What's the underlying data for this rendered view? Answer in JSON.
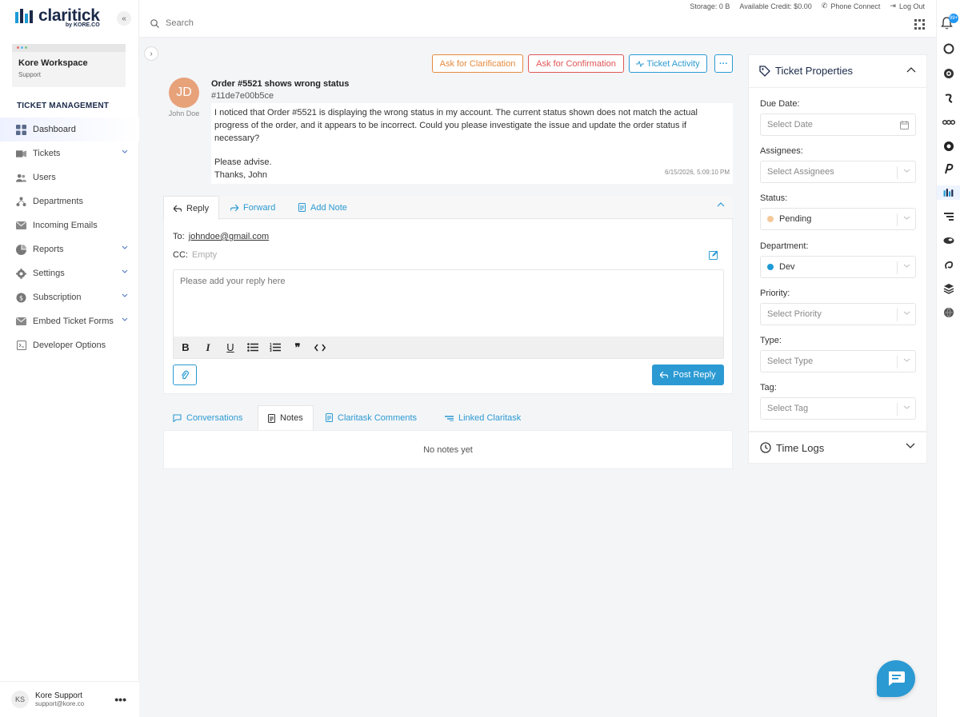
{
  "brand": {
    "name": "claritick",
    "by": "by KORE.CO",
    "accent": "#2b9ad3"
  },
  "topbar": {
    "storage": "Storage: 0 B",
    "credit": "Available Credit: $0.00",
    "phone": "Phone Connect",
    "logout": "Log Out",
    "search_placeholder": "Search",
    "notification_count": "99+"
  },
  "sidebar": {
    "workspace_name": "Kore Workspace",
    "workspace_role": "Support",
    "section_title": "TICKET MANAGEMENT",
    "items": [
      {
        "label": "Dashboard",
        "icon": "dashboard-icon"
      },
      {
        "label": "Tickets",
        "icon": "ticket-icon"
      },
      {
        "label": "Users",
        "icon": "users-icon"
      },
      {
        "label": "Departments",
        "icon": "departments-icon"
      },
      {
        "label": "Incoming Emails",
        "icon": "mail-icon"
      },
      {
        "label": "Reports",
        "icon": "reports-icon"
      },
      {
        "label": "Settings",
        "icon": "gear-icon"
      },
      {
        "label": "Subscription",
        "icon": "subscription-icon"
      },
      {
        "label": "Embed Ticket Forms",
        "icon": "embed-icon"
      },
      {
        "label": "Developer Options",
        "icon": "developer-icon"
      }
    ],
    "user": {
      "initials": "KS",
      "name": "Kore Support",
      "email": "support@kore.co"
    }
  },
  "actions": {
    "clarification": "Ask for Clarification",
    "confirmation": "Ask for Confirmation",
    "activity": "Ticket Activity",
    "more": "···"
  },
  "ticket": {
    "avatar_initials": "JD",
    "author": "John Doe",
    "title": "Order #5521 shows wrong status",
    "id": "#11de7e00b5ce",
    "body_lines": [
      "I noticed that Order #5521 is displaying the wrong status in my account. The current status shown does not match the actual progress of the order, and it appears to be incorrect. Could you please investigate the issue and update the order status if necessary?",
      "Please advise.",
      "Thanks, John"
    ],
    "timestamp": "6/15/2026, 5:09:10 PM"
  },
  "reply": {
    "tabs": [
      "Reply",
      "Forward",
      "Add Note"
    ],
    "to_label": "To:",
    "to_value": "johndoe@gmail.com",
    "cc_label": "CC:",
    "cc_value": "Empty",
    "placeholder": "Please add your reply here",
    "post_label": "Post Reply"
  },
  "bottom_tabs": [
    "Conversations",
    "Notes",
    "Claritask Comments",
    "Linked Claritask"
  ],
  "notes_empty": "No notes yet",
  "properties": {
    "title": "Ticket Properties",
    "due_date_label": "Due Date:",
    "due_date_placeholder": "Select Date",
    "assignees_label": "Assignees:",
    "assignees_placeholder": "Select Assignees",
    "status_label": "Status:",
    "status_value": "Pending",
    "status_color": "#f5c89a",
    "department_label": "Department:",
    "department_value": "Dev",
    "department_color": "#1e9ad6",
    "priority_label": "Priority:",
    "priority_placeholder": "Select Priority",
    "type_label": "Type:",
    "type_placeholder": "Select Type",
    "tag_label": "Tag:",
    "tag_placeholder": "Select Tag",
    "time_logs": "Time Logs"
  }
}
